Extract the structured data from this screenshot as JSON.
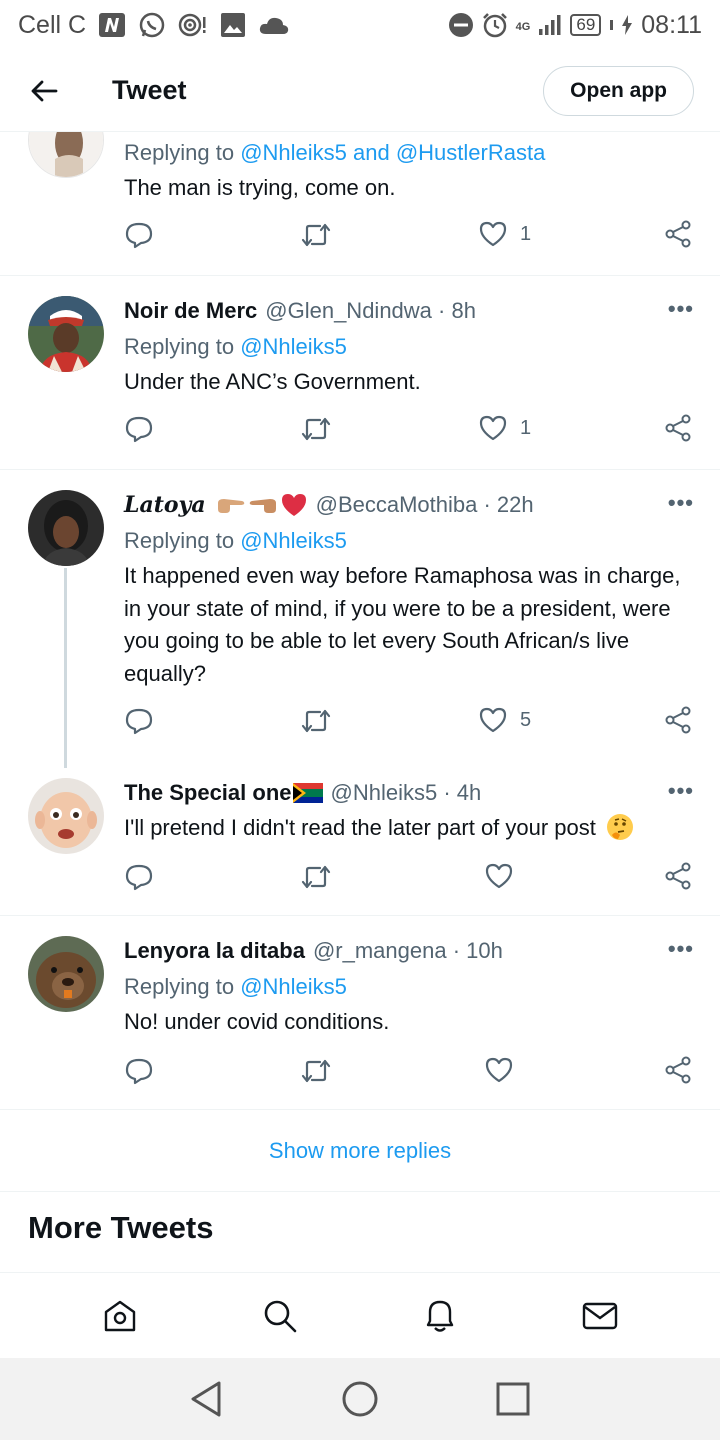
{
  "status_bar": {
    "carrier": "Cell C",
    "network": "4G",
    "battery": "69",
    "time": "08:11"
  },
  "header": {
    "title": "Tweet",
    "open_app": "Open app"
  },
  "tweets": [
    {
      "reply_prefix": "Replying to ",
      "mention_1": "@Nhleiks5",
      "reply_and": " and ",
      "mention_2": "@HustlerRasta",
      "text": "The man is trying, come on.",
      "likes": "1"
    },
    {
      "name": "Noir de Merc",
      "handle": "@Glen_Ndindwa · 8h",
      "reply_prefix": "Replying to ",
      "mention_1": "@Nhleiks5",
      "text": "Under the ANC’s Government.",
      "likes": "1"
    },
    {
      "name": "Latoya",
      "handle": "@BeccaMothiba · 22h",
      "reply_prefix": "Replying to ",
      "mention_1": "@Nhleiks5",
      "text": "It happened even way before Ramaphosa was in charge, in your state of mind, if you were to be a president, were you going to be able to let every South African/s live equally?",
      "likes": "5"
    },
    {
      "name": "The Special one",
      "handle": "@Nhleiks5 · 4h",
      "text": "I'll pretend I didn't read the later part of your post",
      "likes": ""
    },
    {
      "name": "Lenyora la ditaba",
      "handle": "@r_mangena · 10h",
      "reply_prefix": "Replying to ",
      "mention_1": "@Nhleiks5",
      "text": "No! under covid conditions.",
      "likes": ""
    }
  ],
  "more_glyph": "•••",
  "show_more": "Show more replies",
  "more_tweets": "More Tweets",
  "colors": {
    "accent": "#1d9bf0",
    "secondary_text": "#536471",
    "primary_text": "#0f1419",
    "divider": "#eff3f4"
  }
}
